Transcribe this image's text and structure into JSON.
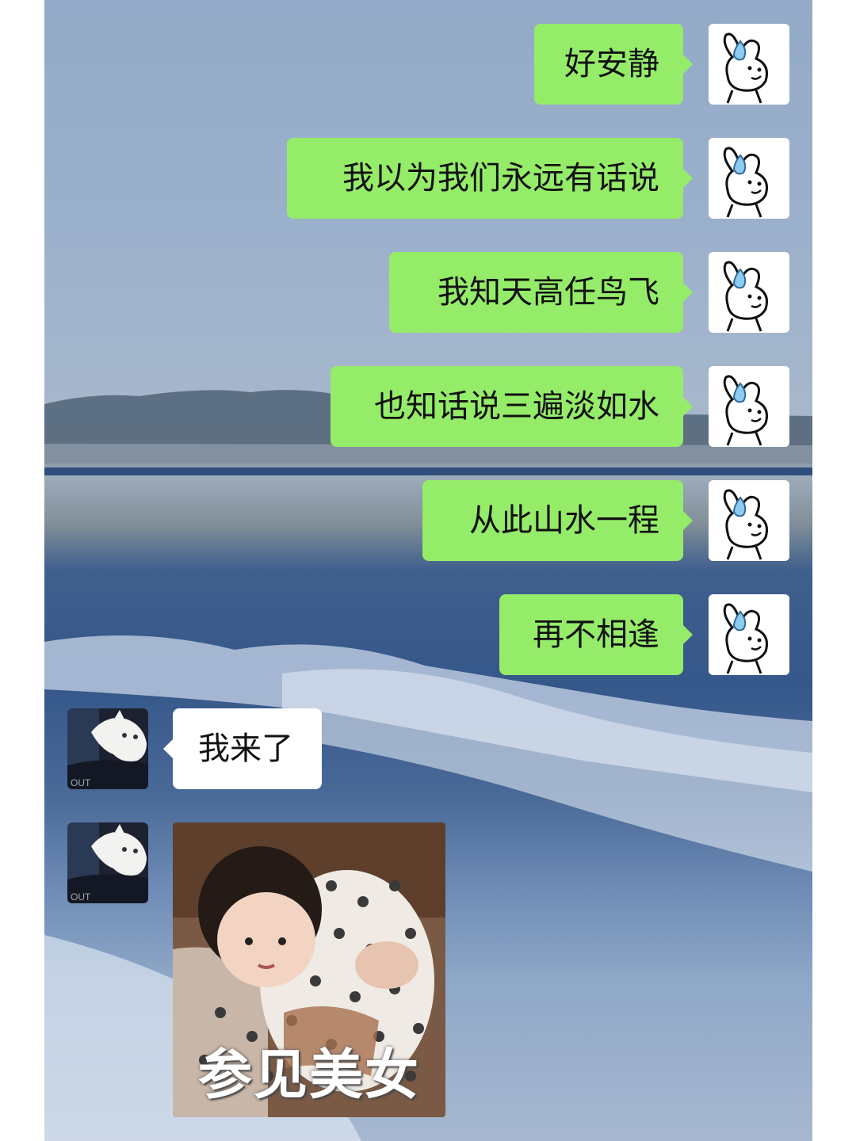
{
  "chat": {
    "outgoing": [
      {
        "text": "好安静"
      },
      {
        "text": "我以为我们永远有话说"
      },
      {
        "text": "我知天高任鸟飞"
      },
      {
        "text": "也知话说三遍淡如水"
      },
      {
        "text": "从此山水一程"
      },
      {
        "text": "再不相逢"
      }
    ],
    "incoming": [
      {
        "text": "我来了"
      }
    ],
    "sticker": {
      "caption": "参见美女"
    }
  },
  "colors": {
    "outgoing_bubble": "#95ec69",
    "incoming_bubble": "#ffffff"
  },
  "icons": {
    "self_avatar": "rabbit-sweat-icon",
    "other_avatar": "white-cat-photo"
  }
}
